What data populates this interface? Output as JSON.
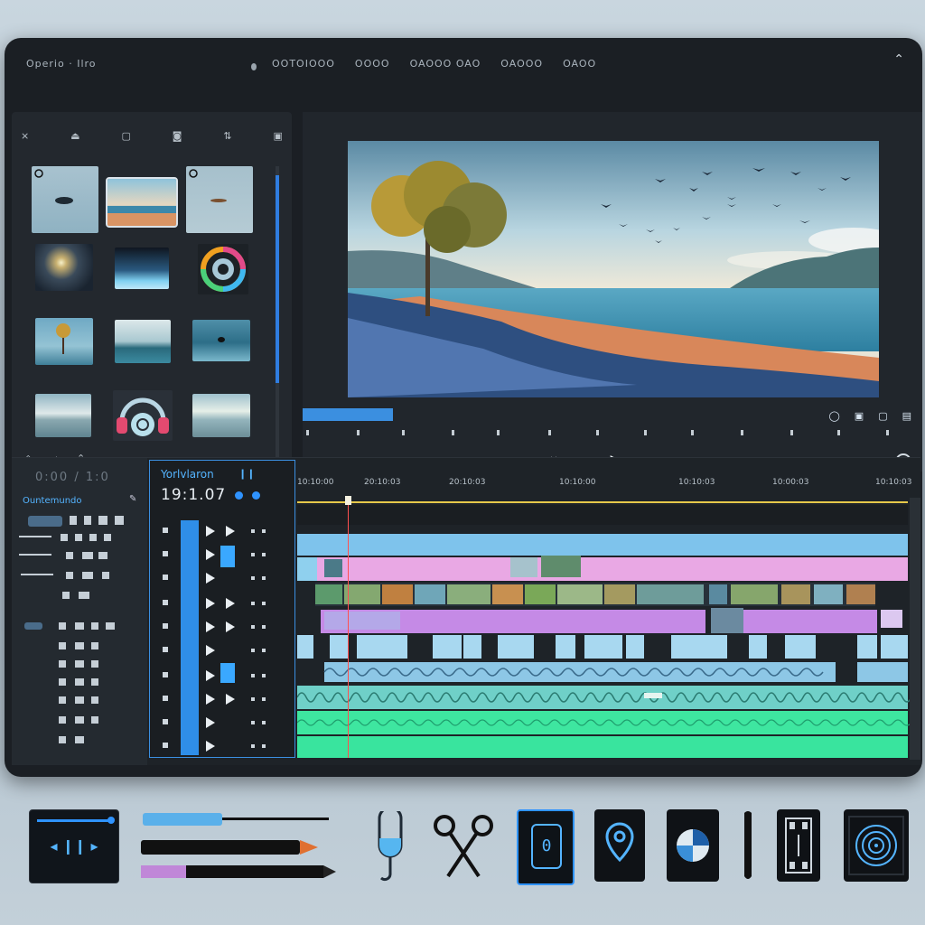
{
  "titlebar": {
    "left_text": "Operio · Ilro",
    "menu": [
      "OOTOIOOO",
      "OOOO",
      "OAOOO OAO",
      "OAOOO",
      "OAOO"
    ]
  },
  "media_browser": {
    "toolbar_icons": [
      "panel-close-icon",
      "eject-icon",
      "square-icon",
      "stop-icon",
      "sort-icon",
      "crop-icon"
    ],
    "thumbnails": [
      {
        "name": "lake-shadow"
      },
      {
        "name": "beach-sunset"
      },
      {
        "name": "dark-spot"
      },
      {
        "name": "night-glow"
      },
      {
        "name": "blue-horizon"
      },
      {
        "name": "color-wheel"
      },
      {
        "name": "lone-tree"
      },
      {
        "name": "ocean-cloud"
      },
      {
        "name": "dark-sea"
      },
      {
        "name": "sky-horizon"
      },
      {
        "name": "headphones"
      },
      {
        "name": "cloudy-sea"
      }
    ]
  },
  "viewer": {
    "controls": [
      "◂",
      "⏮",
      "⏸",
      "▶",
      "⏭",
      "▸",
      "⌐"
    ]
  },
  "timeline": {
    "timecode_small": "0:00 / 1:0",
    "side_title": "Ountemundo",
    "panel_name": "Yorlvlaron",
    "timecode": "19:1.07",
    "ruler": [
      "10:10:00",
      "20:10:03",
      "20:10:03",
      "10:10:00",
      "10:10:03",
      "10:00:03",
      "10:10:03"
    ]
  },
  "colors": {
    "accent": "#2f93ff",
    "video_track": "#7ec3ec",
    "title_track": "#e9a8e4",
    "audio_track": "#3ee6a0"
  }
}
